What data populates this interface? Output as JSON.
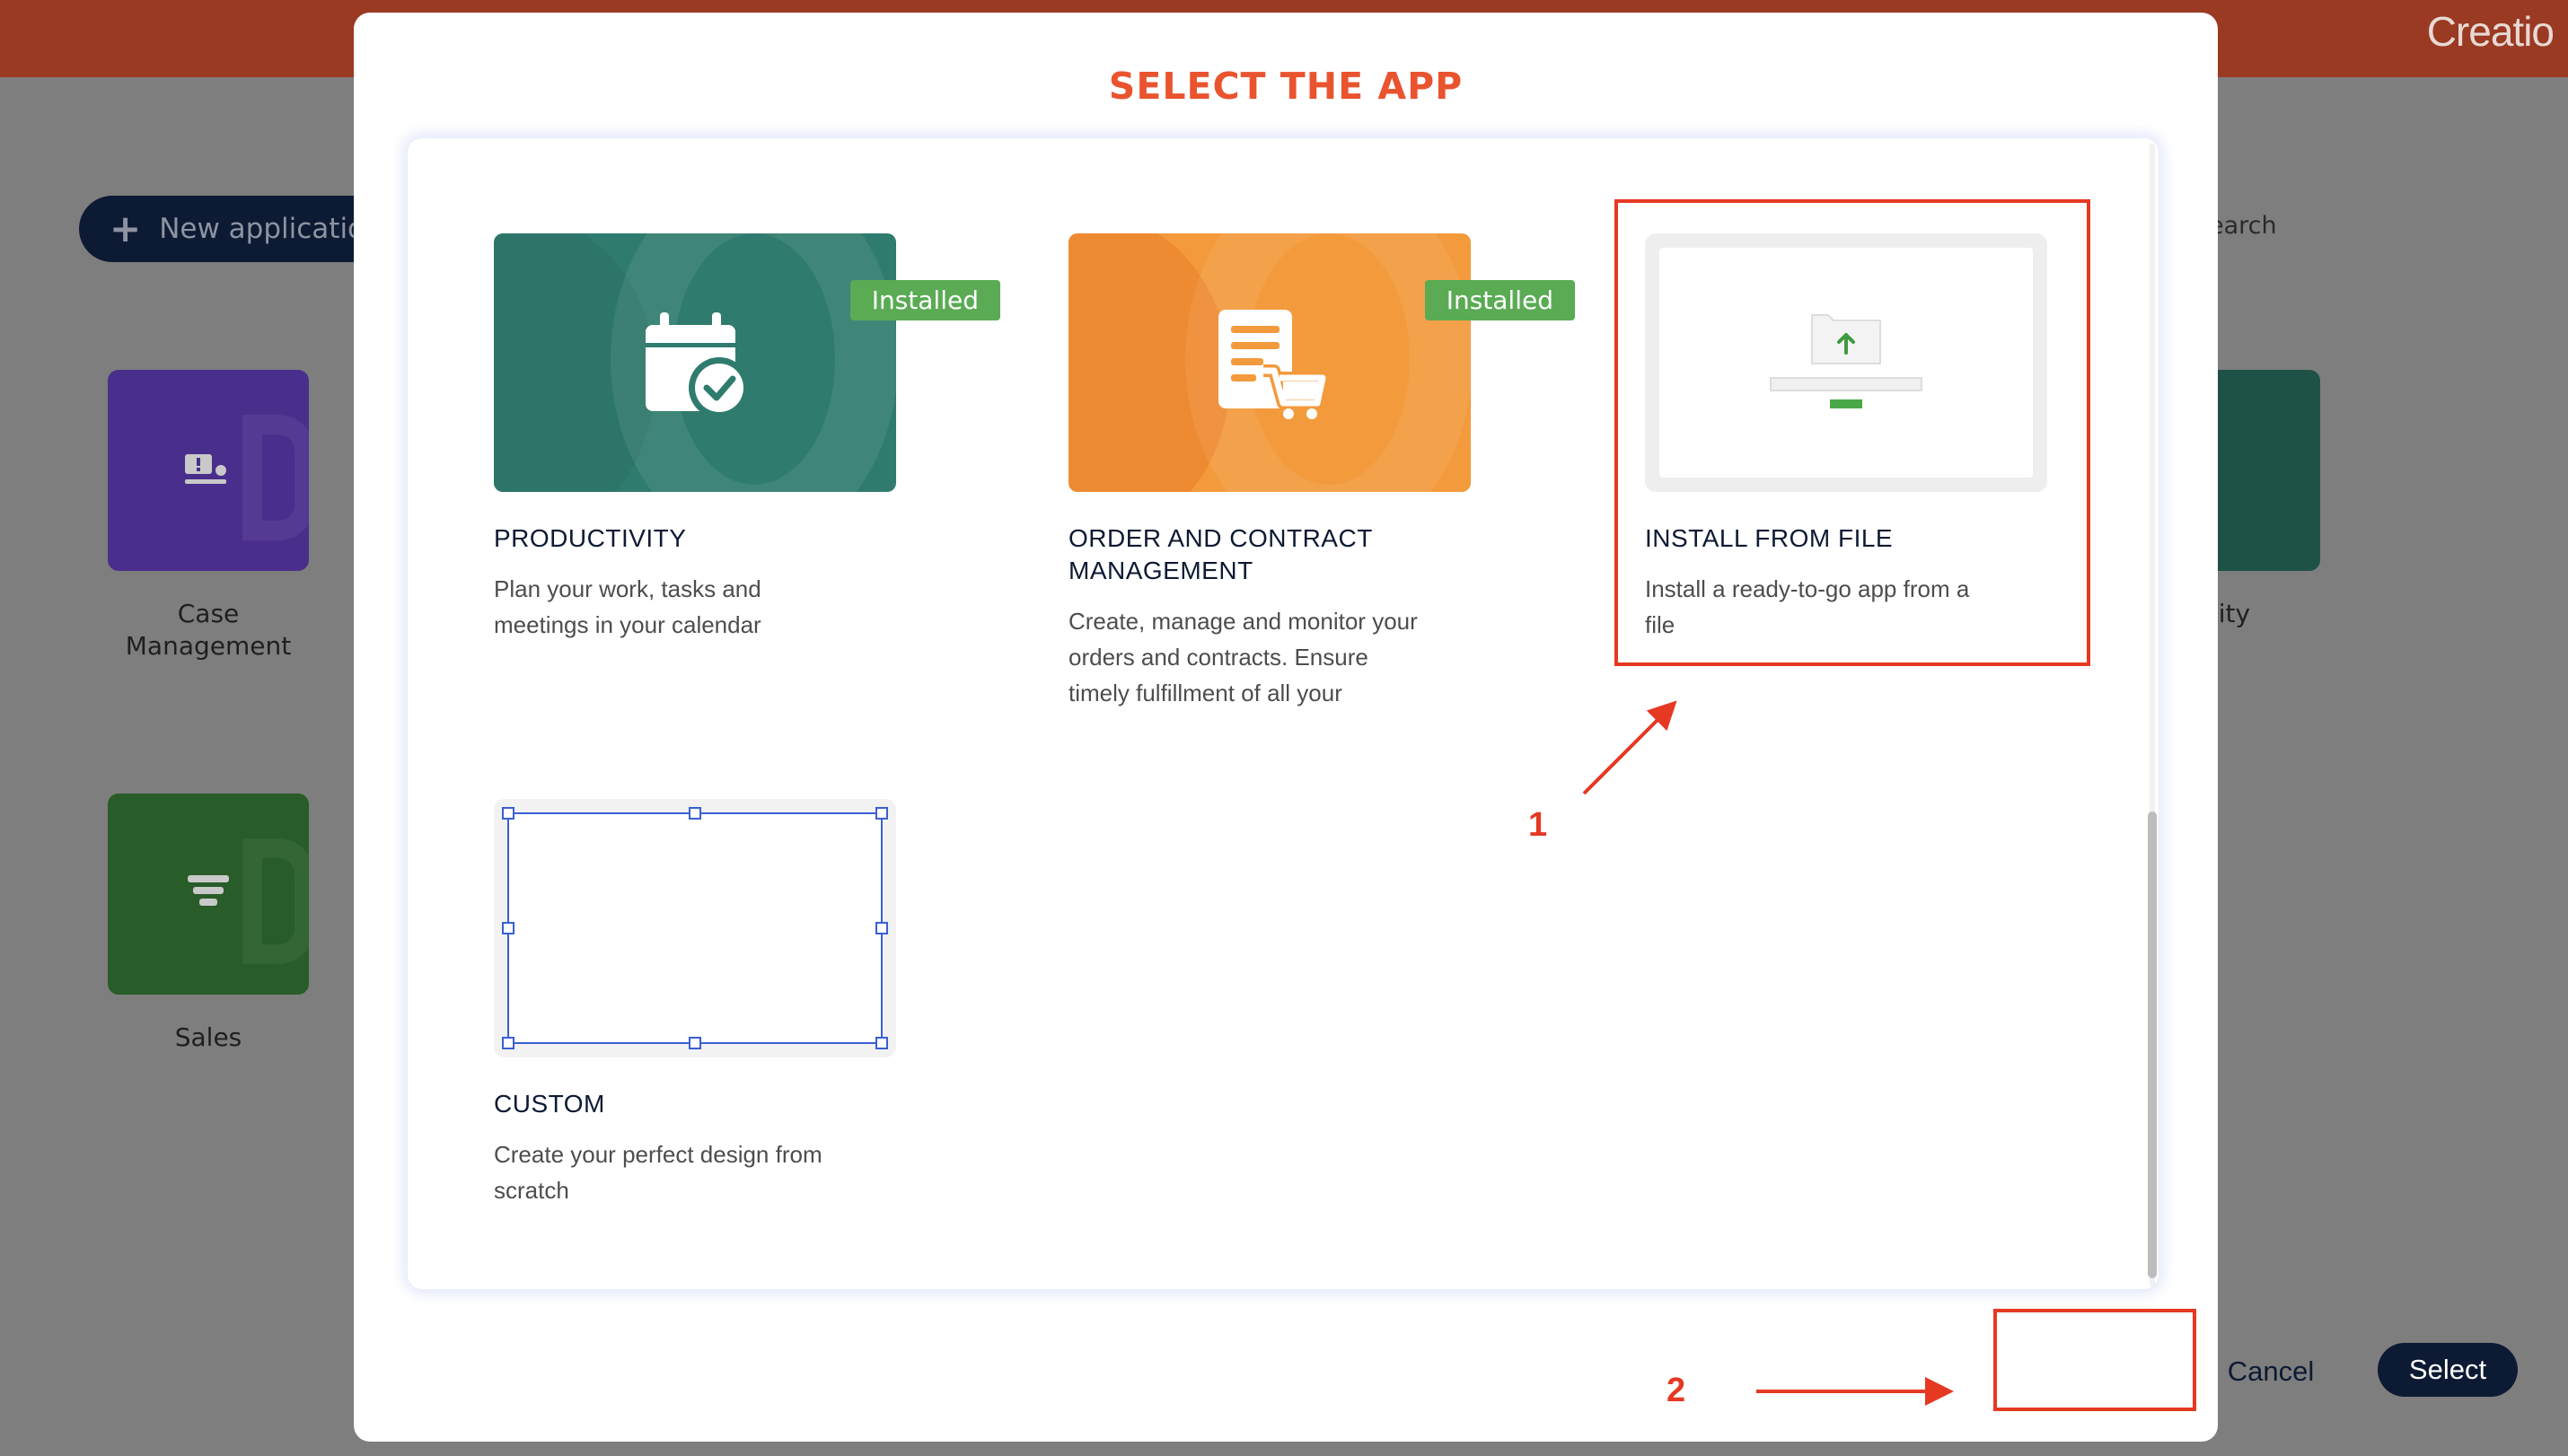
{
  "brand": "Creatio",
  "background": {
    "new_app_label": "New applicatio",
    "search_partial": "earch",
    "tiles": [
      {
        "label": "Case Management",
        "color": "#4a2e8c",
        "icon": "case-icon"
      },
      {
        "label": "Sales",
        "color": "#285c28",
        "icon": "funnel-icon"
      },
      {
        "label": "ctivity",
        "color": "#1f5247",
        "icon": "calendar-check-icon"
      }
    ]
  },
  "modal": {
    "title": "SELECT THE APP",
    "cards": [
      {
        "title": "PRODUCTIVITY",
        "desc_lines": [
          "Plan your work, tasks and",
          "meetings in your calendar"
        ],
        "badge": "Installed",
        "color": "#2f7c6e"
      },
      {
        "title_lines": [
          "ORDER AND CONTRACT",
          "MANAGEMENT"
        ],
        "desc_lines": [
          "Create, manage and monitor your",
          "orders and contracts. Ensure",
          "timely fulfillment of all your"
        ],
        "badge": "Installed",
        "color": "#f39a3c"
      },
      {
        "title": "INSTALL FROM FILE",
        "desc_lines": [
          "Install a ready-to-go app from a",
          "file"
        ]
      },
      {
        "title": "CUSTOM",
        "desc_lines": [
          "Create your perfect design from",
          "scratch"
        ]
      }
    ],
    "cancel_label": "Cancel",
    "select_label": "Select"
  },
  "annotations": {
    "step1": "1",
    "step2": "2",
    "color": "#e53924"
  }
}
